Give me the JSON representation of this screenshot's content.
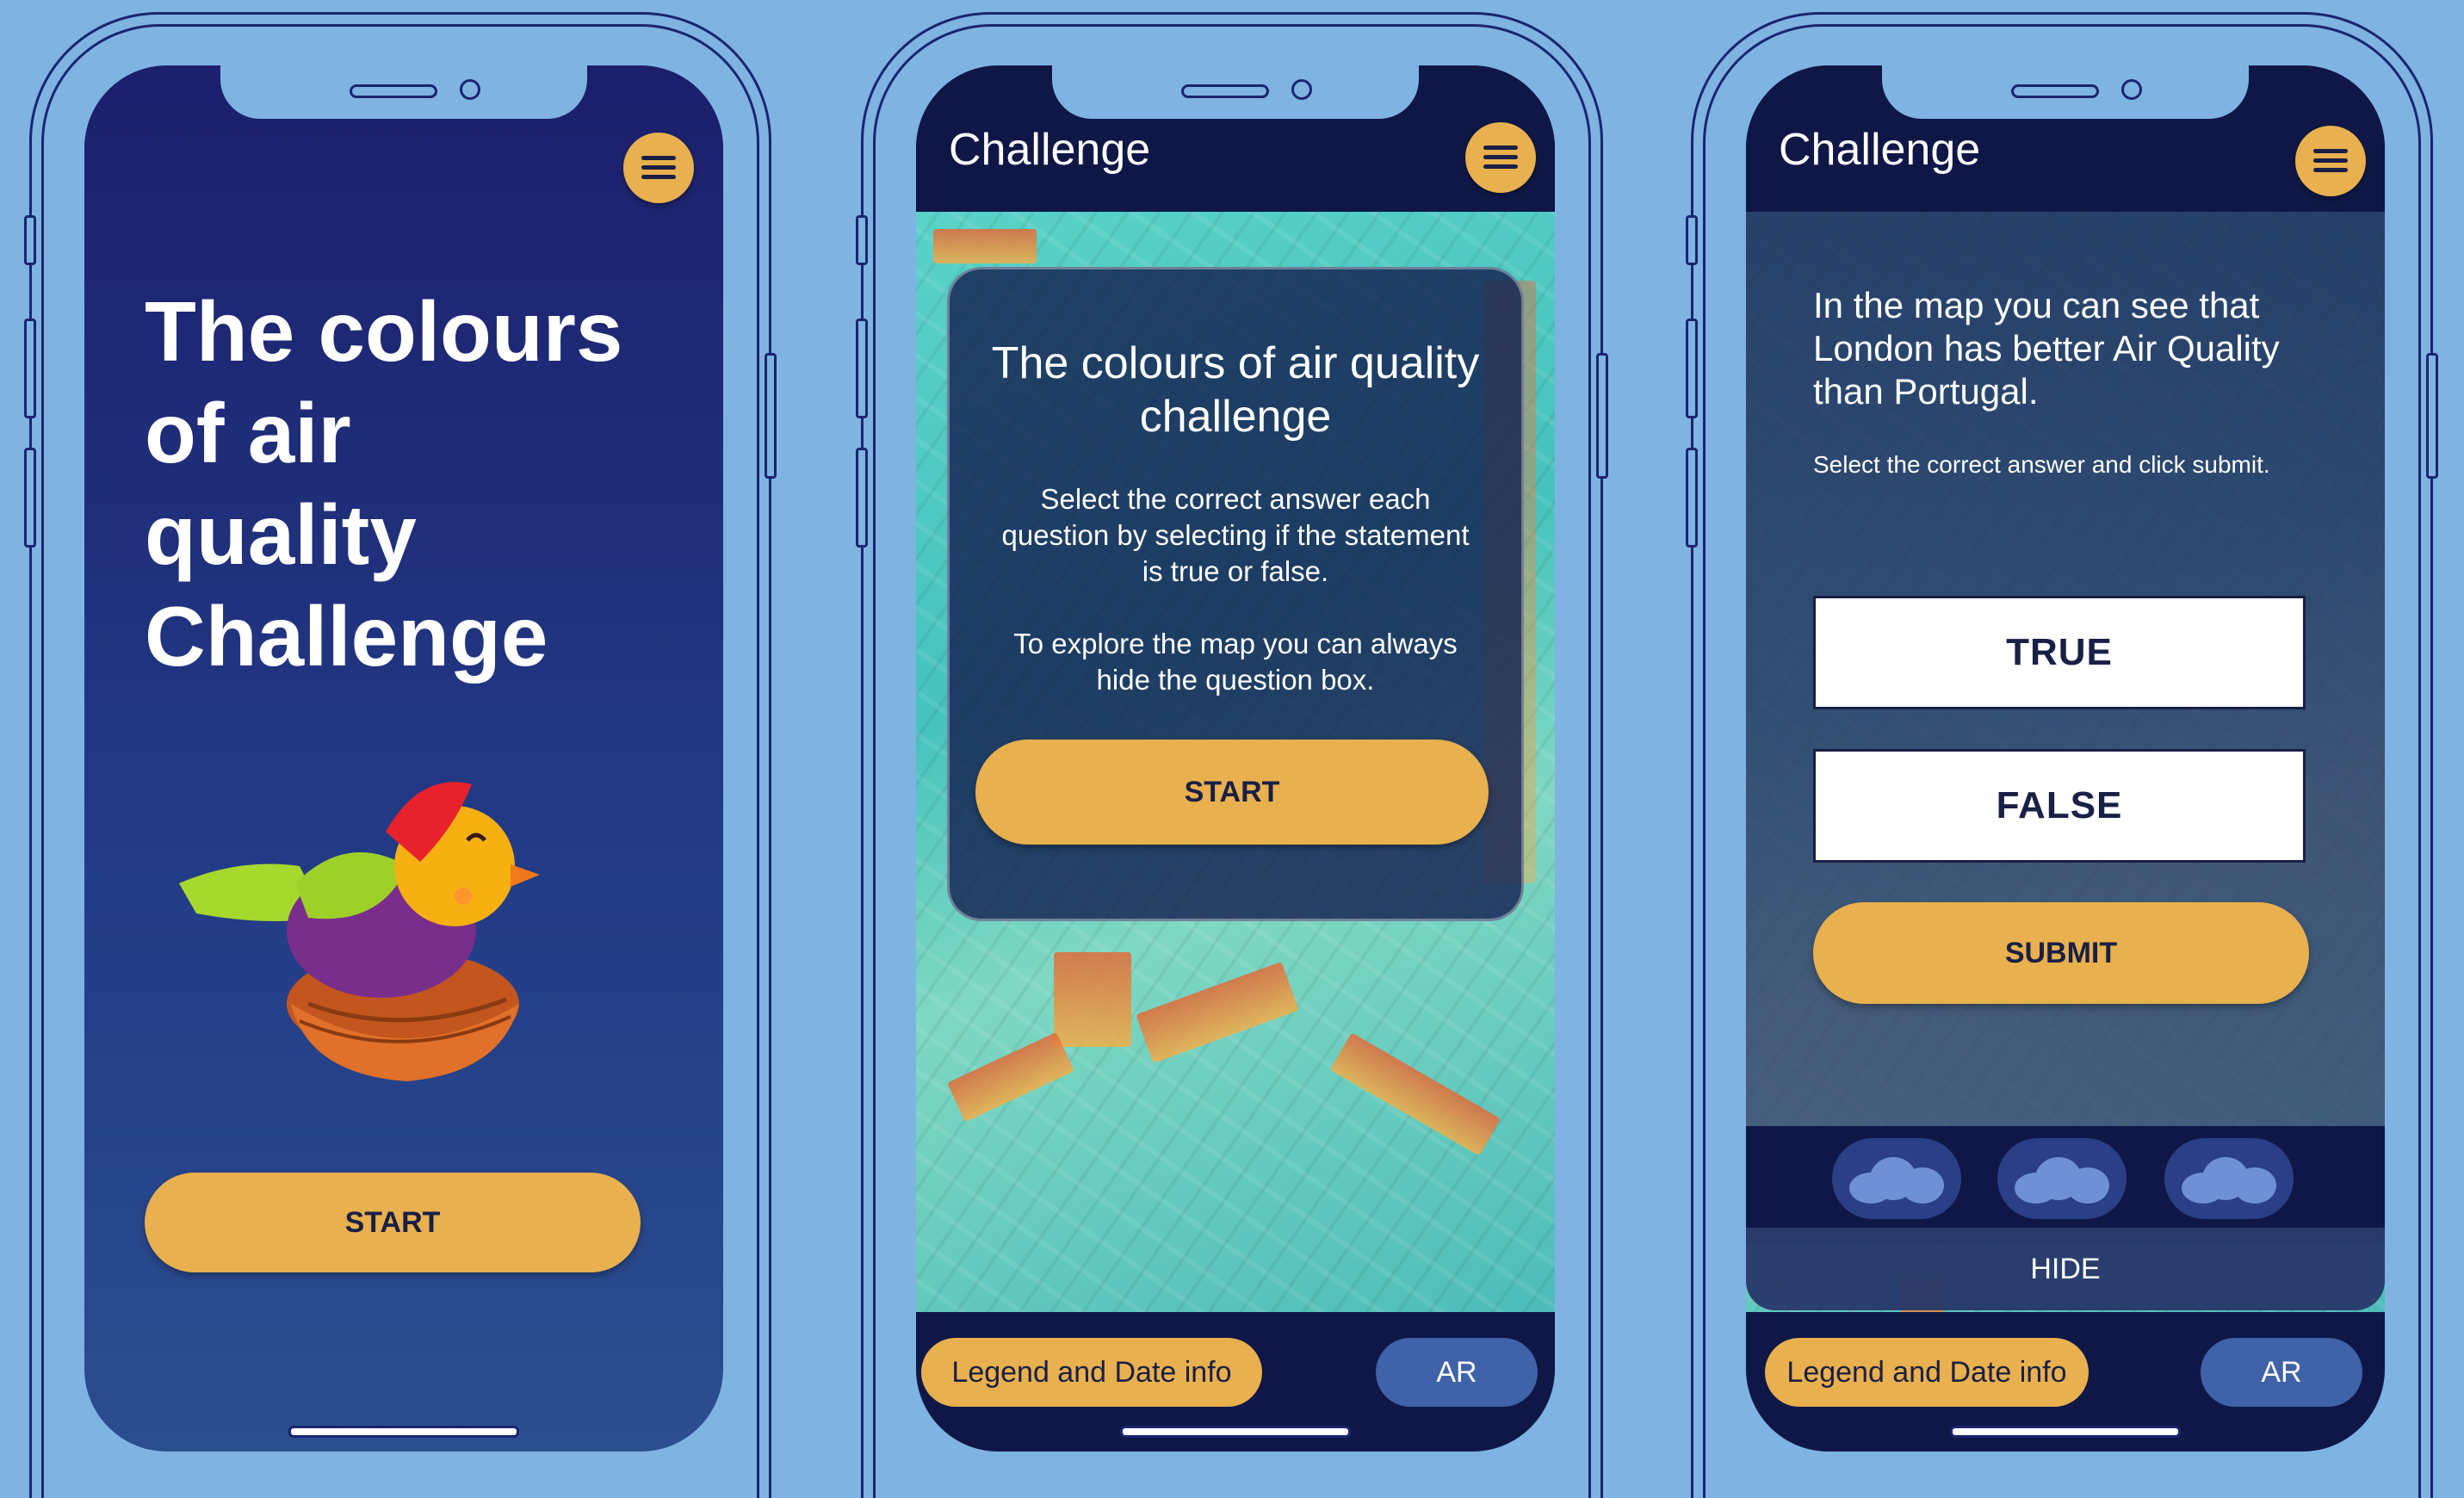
{
  "phones": {
    "intro": {
      "title": "The colours of air quality Challenge",
      "start_label": "START"
    },
    "instructions": {
      "header_title": "Challenge",
      "card_title": "The colours of air quality challenge",
      "card_text_1": "Select the correct answer each question by selecting if the statement is true or false.",
      "card_text_2": "To explore the map you can always hide the question box.",
      "start_label": "START",
      "legend_label": "Legend and Date info",
      "ar_label": "AR"
    },
    "question": {
      "header_title": "Challenge",
      "question_text": "In the map you can see that London has better Air Quality than Portugal.",
      "hint": "Select the correct answer and click submit.",
      "true_label": "TRUE",
      "false_label": "FALSE",
      "submit_label": "SUBMIT",
      "hide_label": "HIDE",
      "legend_label": "Legend and Date info",
      "ar_label": "AR"
    }
  },
  "icons": {
    "menu": "hamburger-icon",
    "mascot": "bird-in-nest",
    "cloud": "cloud-icon"
  },
  "colors": {
    "background": "#7fb3e2",
    "accent": "#e8b04e",
    "navy": "#0f1747",
    "ar_button": "#3f62a8"
  }
}
